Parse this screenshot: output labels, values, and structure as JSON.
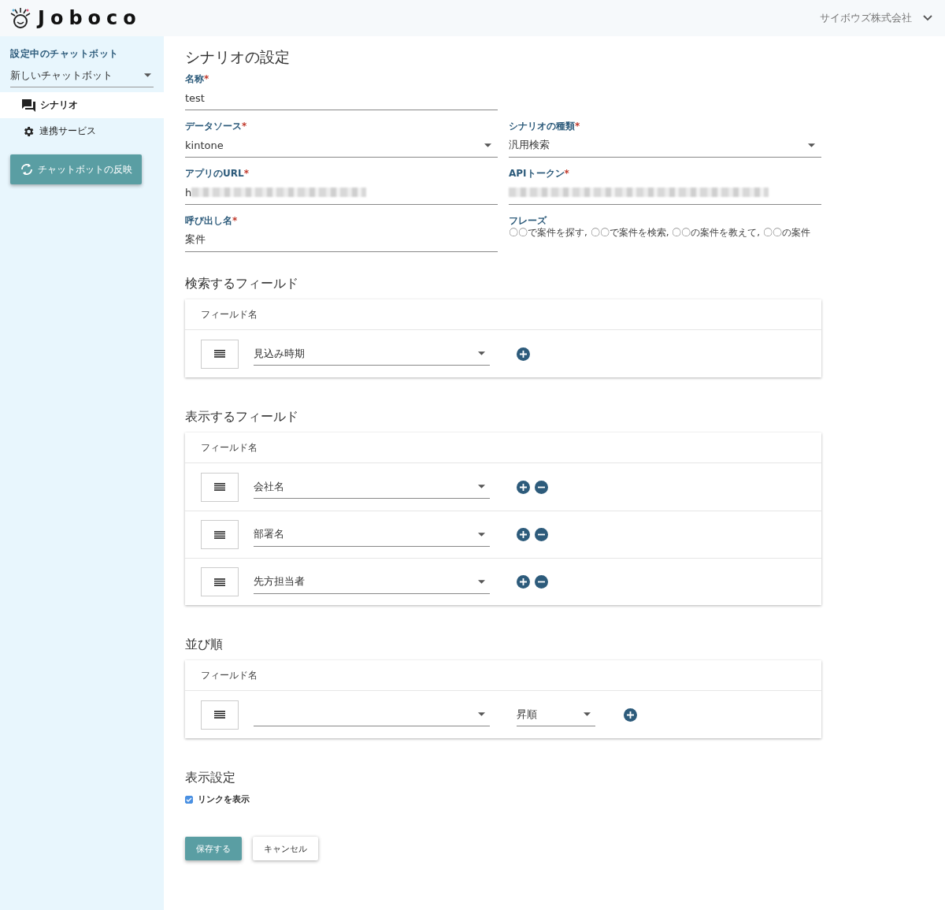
{
  "header": {
    "logo": "Joboco",
    "account": "サイボウズ株式会社"
  },
  "sidebar": {
    "bot_label": "設定中のチャットボット",
    "bot_value": "新しいチャットボット",
    "items": [
      {
        "label": "シナリオ",
        "selected": true
      },
      {
        "label": "連携サービス",
        "selected": false
      }
    ],
    "apply_button": "チャットボットの反映"
  },
  "form": {
    "title": "シナリオの設定",
    "rows": [
      [
        {
          "kind": "text",
          "label": "名称",
          "required_mark": "*",
          "value": "test"
        }
      ],
      [
        {
          "kind": "select",
          "label": "データソース",
          "required_mark": "*",
          "value": "kintone"
        },
        {
          "kind": "select",
          "label": "シナリオの種類",
          "required_mark": "*",
          "value": "汎用検索"
        }
      ],
      [
        {
          "kind": "redacted",
          "label": "アプリのURL",
          "required_mark": "*",
          "value": "h"
        },
        {
          "kind": "redacted",
          "label": "APIトークン",
          "required_mark": "*"
        }
      ],
      [
        {
          "kind": "text",
          "label": "呼び出し名",
          "required_mark": "*",
          "value": "案件"
        },
        {
          "kind": "static",
          "label": "フレーズ",
          "value": "〇〇で案件を探す, 〇〇で案件を検索, 〇〇の案件を教えて, 〇〇の案件"
        }
      ]
    ]
  },
  "sections": [
    {
      "title": "検索するフィールド",
      "column_header": "フィールド名",
      "rows": [
        {
          "value": "見込み時期",
          "removable": false
        }
      ]
    },
    {
      "title": "表示するフィールド",
      "column_header": "フィールド名",
      "rows": [
        {
          "value": "会社名",
          "removable": true
        },
        {
          "value": "部署名",
          "removable": true
        },
        {
          "value": "先方担当者",
          "removable": true
        }
      ]
    },
    {
      "title": "並び順",
      "column_header": "フィールド名",
      "rows": [
        {
          "order": "昇順",
          "removable": false
        }
      ]
    }
  ],
  "display_settings": {
    "title": "表示設定",
    "checkbox": {
      "label": "リンクを表示",
      "checked": true
    }
  },
  "buttons": {
    "save": "保存する",
    "cancel": "キャンセル"
  }
}
